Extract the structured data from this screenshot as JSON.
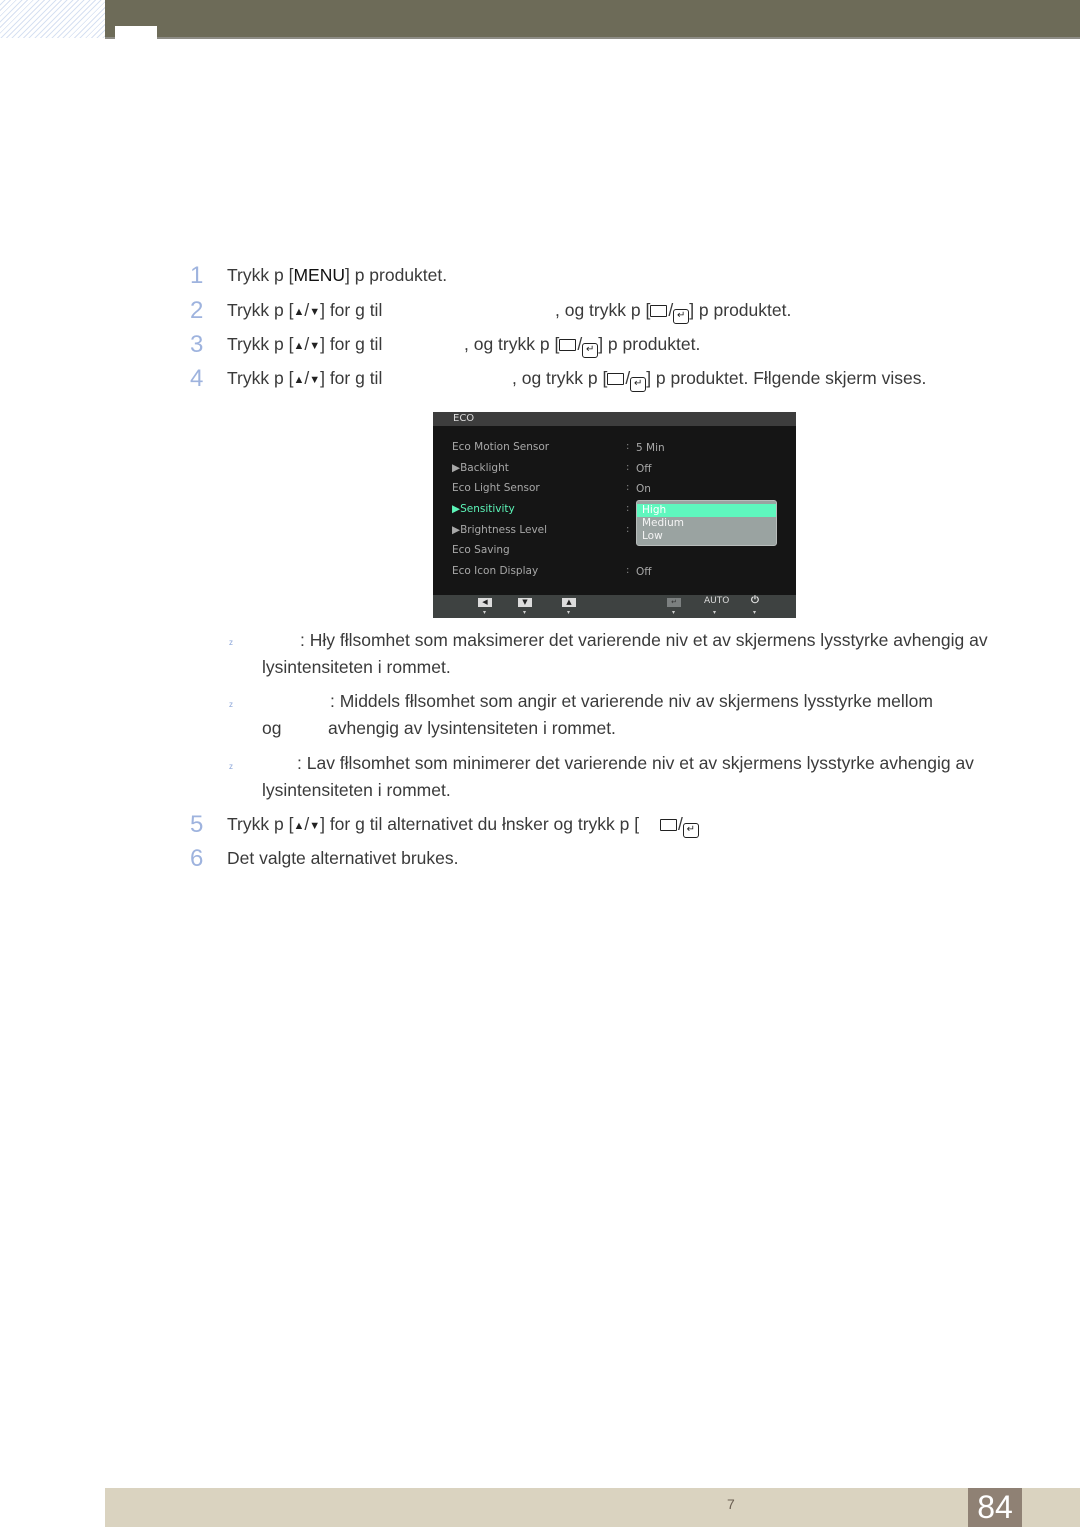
{
  "header": {
    "decorative": true
  },
  "steps": [
    {
      "num": "1",
      "parts": [
        "Trykk p  [",
        "MENU",
        "] p  produktet."
      ]
    },
    {
      "num": "2",
      "parts": [
        "Trykk p  [",
        "] for   g  til",
        ", og trykk p  [",
        "] p  produktet."
      ]
    },
    {
      "num": "3",
      "parts": [
        "Trykk p  [",
        "] for   g  til",
        ", og trykk p  [",
        "] p  produktet."
      ]
    },
    {
      "num": "4",
      "parts": [
        "Trykk p  [",
        "] for   g  til",
        ", og trykk p  [",
        "] p  produktet. Fłlgende skjerm vises."
      ]
    },
    {
      "num": "5",
      "parts": [
        "Trykk p  [",
        "] for   g  til alternativet du łnsker og trykk p  ["
      ]
    },
    {
      "num": "6",
      "parts": [
        "Det valgte alternativet brukes."
      ]
    }
  ],
  "icons": {
    "up": "▲",
    "slash": "/",
    "down": "▼",
    "enter": "↵"
  },
  "osd": {
    "title": "ECO",
    "rows": [
      {
        "label": "Eco Motion Sensor",
        "arrow": false,
        "value": "5 Min"
      },
      {
        "label": "Backlight",
        "arrow": true,
        "value": "Off"
      },
      {
        "label": "Eco Light Sensor",
        "arrow": false,
        "value": "On"
      },
      {
        "label": "Sensitivity",
        "arrow": true,
        "value": "",
        "active": true
      },
      {
        "label": "Brightness Level",
        "arrow": true,
        "value": ""
      },
      {
        "label": "Eco Saving",
        "arrow": false,
        "value": ""
      },
      {
        "label": "Eco Icon Display",
        "arrow": false,
        "value": "Off"
      }
    ],
    "colon": ":",
    "dropdown": {
      "options": [
        "High",
        "Medium",
        "Low"
      ],
      "selected": "High"
    },
    "bottom_keys": {
      "left": "◀",
      "down": "▼",
      "up": "▲",
      "enter": "↵",
      "auto": "AUTO",
      "power": "⏻",
      "tick": "▾"
    },
    "colors": {
      "active": "#5cf5b8",
      "selected_bg": "#5ff7be",
      "dropdown_bg": "#9aa3a1"
    }
  },
  "bullets": [
    {
      "mark": "z",
      "line1": ": Hły fłlsomhet som maksimerer  det varierende niv et av skjermens lysstyrke avhengig av",
      "line2": "lysintensiteten i rommet."
    },
    {
      "mark": "z",
      "line1": ": Middels fłlsomhet som angir et varierende niv  av skjermens lysstyrke mellom",
      "line2a": "og",
      "line2b": "avhengig av lysintensiteten i rommet."
    },
    {
      "mark": "z",
      "line1": ": Lav fłlsomhet som minimerer det varierende niv et av skjermens lysstyrke avhengig av",
      "line2": "lysintensiteten i rommet."
    }
  ],
  "footer": {
    "chapter": "7",
    "page": "84"
  },
  "colors": {
    "step_number": "#9eb3de",
    "header_bar": "#6d6b58",
    "footer_bar": "#dad3c0",
    "page_box": "#8f8174"
  }
}
